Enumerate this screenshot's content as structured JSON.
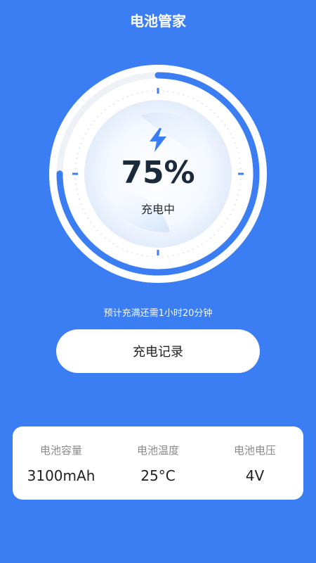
{
  "header": {
    "title": "电池管家"
  },
  "battery": {
    "percent_text": "75%",
    "level": 0.75,
    "status": "充电中",
    "estimate": "预计充满还需1小时20分钟"
  },
  "actions": {
    "record_label": "充电记录"
  },
  "info": [
    {
      "label": "电池容量",
      "value": "3100mAh"
    },
    {
      "label": "电池温度",
      "value": "25°C"
    },
    {
      "label": "电池电压",
      "value": "4V"
    }
  ],
  "colors": {
    "background": "#3B7EF4",
    "accent": "#3B7EF4",
    "track": "#EEF1F6",
    "text_dark": "#1a2a3a"
  },
  "icons": {
    "charging": "lightning-bolt-icon"
  }
}
